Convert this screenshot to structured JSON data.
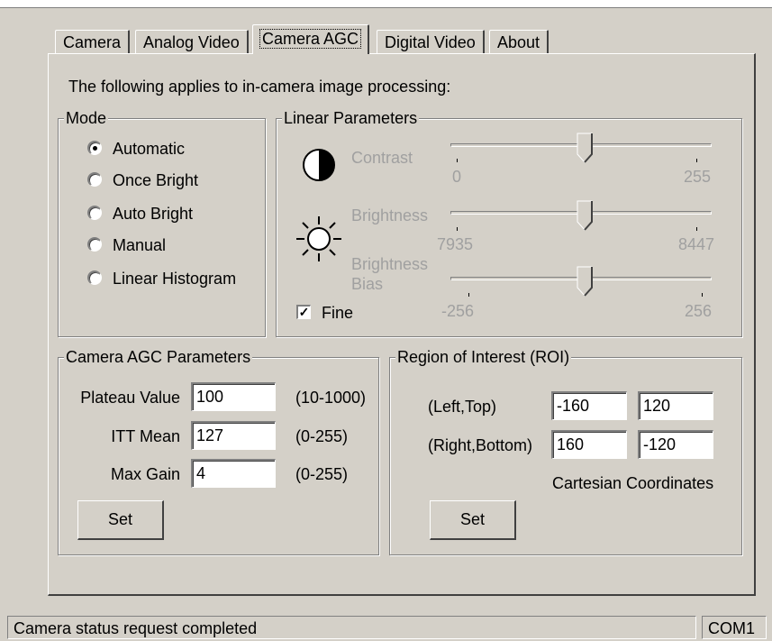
{
  "tabs": [
    {
      "label": "Camera"
    },
    {
      "label": "Analog Video"
    },
    {
      "label": "Camera AGC"
    },
    {
      "label": "Digital Video"
    },
    {
      "label": "About"
    }
  ],
  "intro_text": "The following applies to in-camera image processing:",
  "mode": {
    "title": "Mode",
    "options": [
      {
        "label": "Automatic",
        "checked": true
      },
      {
        "label": "Once Bright",
        "checked": false
      },
      {
        "label": "Auto Bright",
        "checked": false
      },
      {
        "label": "Manual",
        "checked": false
      },
      {
        "label": "Linear Histogram",
        "checked": false
      }
    ]
  },
  "linear": {
    "title": "Linear Parameters",
    "contrast": {
      "label": "Contrast",
      "min": "0",
      "max": "255",
      "icon": "contrast-icon"
    },
    "brightness": {
      "label": "Brightness",
      "min": "7935",
      "max": "8447",
      "icon": "sun-icon"
    },
    "bias": {
      "label_line1": "Brightness",
      "label_line2": "Bias",
      "min": "-256",
      "max": "256"
    },
    "fine": {
      "label": "Fine",
      "checked": true
    }
  },
  "agc": {
    "title": "Camera AGC Parameters",
    "plateau": {
      "label": "Plateau Value",
      "value": "100",
      "range": "(10-1000)"
    },
    "itt": {
      "label": "ITT Mean",
      "value": "127",
      "range": "(0-255)"
    },
    "gain": {
      "label": "Max Gain",
      "value": "4",
      "range": "(0-255)"
    },
    "set_label": "Set"
  },
  "roi": {
    "title": "Region of Interest (ROI)",
    "left_top": {
      "label": "(Left,Top)",
      "v1": "-160",
      "v2": "120"
    },
    "right_bottom": {
      "label": "(Right,Bottom)",
      "v1": "160",
      "v2": "-120"
    },
    "coords_label": "Cartesian Coordinates",
    "set_label": "Set"
  },
  "status": {
    "message": "Camera status request completed",
    "port": "COM1"
  }
}
